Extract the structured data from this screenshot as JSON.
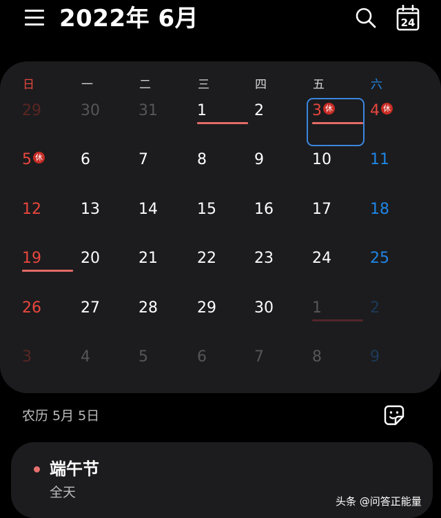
{
  "header": {
    "title": "2022年 6月",
    "today_icon_text": "24"
  },
  "weekdays": [
    "日",
    "一",
    "二",
    "三",
    "四",
    "五",
    "六"
  ],
  "weeks": [
    [
      {
        "day": "29",
        "tone": "redfade"
      },
      {
        "day": "30",
        "tone": "fade"
      },
      {
        "day": "31",
        "tone": "fade"
      },
      {
        "day": "1",
        "tone": "white",
        "underline": "red"
      },
      {
        "day": "2",
        "tone": "white"
      },
      {
        "day": "3",
        "tone": "red",
        "badge": "休",
        "underline": "red",
        "selected": true
      },
      {
        "day": "4",
        "tone": "red",
        "badge": "休"
      }
    ],
    [
      {
        "day": "5",
        "tone": "red",
        "badge": "休"
      },
      {
        "day": "6",
        "tone": "white"
      },
      {
        "day": "7",
        "tone": "white"
      },
      {
        "day": "8",
        "tone": "white"
      },
      {
        "day": "9",
        "tone": "white"
      },
      {
        "day": "10",
        "tone": "white"
      },
      {
        "day": "11",
        "tone": "blue"
      }
    ],
    [
      {
        "day": "12",
        "tone": "red"
      },
      {
        "day": "13",
        "tone": "white"
      },
      {
        "day": "14",
        "tone": "white"
      },
      {
        "day": "15",
        "tone": "white"
      },
      {
        "day": "16",
        "tone": "white"
      },
      {
        "day": "17",
        "tone": "white"
      },
      {
        "day": "18",
        "tone": "blue"
      }
    ],
    [
      {
        "day": "19",
        "tone": "red",
        "underline": "red"
      },
      {
        "day": "20",
        "tone": "white"
      },
      {
        "day": "21",
        "tone": "white"
      },
      {
        "day": "22",
        "tone": "white"
      },
      {
        "day": "23",
        "tone": "white"
      },
      {
        "day": "24",
        "tone": "white"
      },
      {
        "day": "25",
        "tone": "blue"
      }
    ],
    [
      {
        "day": "26",
        "tone": "red"
      },
      {
        "day": "27",
        "tone": "white"
      },
      {
        "day": "28",
        "tone": "white"
      },
      {
        "day": "29",
        "tone": "white"
      },
      {
        "day": "30",
        "tone": "white"
      },
      {
        "day": "1",
        "tone": "fade",
        "underline": "fade"
      },
      {
        "day": "2",
        "tone": "bluefade"
      }
    ],
    [
      {
        "day": "3",
        "tone": "redfade"
      },
      {
        "day": "4",
        "tone": "fade"
      },
      {
        "day": "5",
        "tone": "fade"
      },
      {
        "day": "6",
        "tone": "fade"
      },
      {
        "day": "7",
        "tone": "fade"
      },
      {
        "day": "8",
        "tone": "fade"
      },
      {
        "day": "9",
        "tone": "bluefade"
      }
    ]
  ],
  "lunar": {
    "text": "农历 5月 5日"
  },
  "event": {
    "title": "端午节",
    "subtitle": "全天"
  },
  "watermark": "头条 @问答正能量",
  "colors": {
    "weekend_red": "#e8473e",
    "saturday_blue": "#1f86e6",
    "selection": "#3b87e0",
    "card": "#1c1c1e",
    "background": "#000000"
  },
  "icons": {
    "menu": "menu-icon",
    "search": "search-icon",
    "today": "calendar-today-icon",
    "sticker": "sticker-icon"
  }
}
